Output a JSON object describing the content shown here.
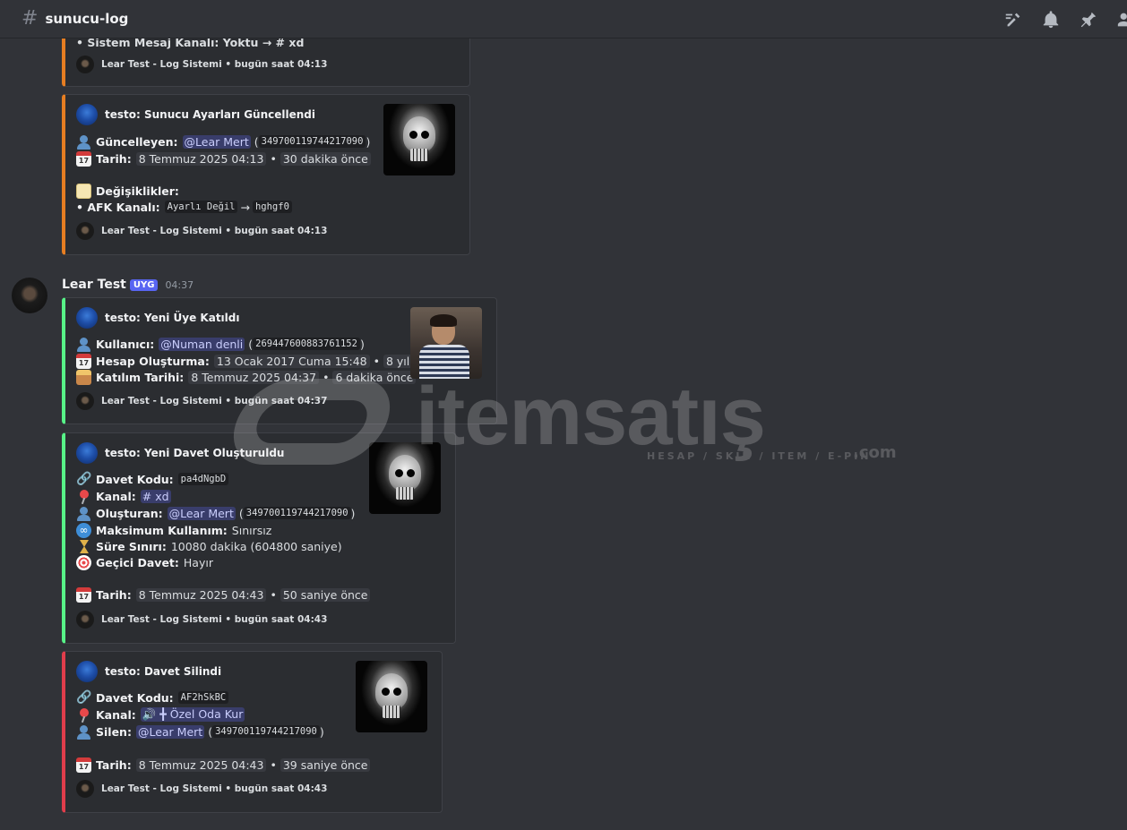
{
  "channel": {
    "name": "sunucu-log"
  },
  "header_icons": [
    "threads-icon",
    "bell-icon",
    "pin-icon",
    "members-icon"
  ],
  "embed0": {
    "partial_line": "• Sistem Mesaj Kanalı: Yoktu → # xd",
    "footer": "Lear Test - Log Sistemi • bugün saat 04:13"
  },
  "embed1": {
    "author": "testo: Sunucu Ayarları Güncellendi",
    "updater_label": "Güncelleyen:",
    "updater_mention": "@Lear Mert",
    "updater_id": "349700119744217090",
    "date_label": "Tarih:",
    "date_value": "8 Temmuz 2025 04:13",
    "date_rel": "30 dakika önce",
    "changes_label": "Değişiklikler:",
    "change_label": "• AFK Kanalı:",
    "change_old": "Ayarlı Değil",
    "change_arrow": "→",
    "change_new": "hghgf0",
    "footer": "Lear Test - Log Sistemi • bugün saat 04:13"
  },
  "message": {
    "username": "Lear Test",
    "tag": "UYG",
    "time": "04:37"
  },
  "embed2": {
    "author": "testo: Yeni Üye Katıldı",
    "user_label": "Kullanıcı:",
    "user_mention": "@Numan denli",
    "user_id": "269447600883761152",
    "created_label": "Hesap Oluşturma:",
    "created_value": "13 Ocak 2017 Cuma 15:48",
    "created_rel": "8 yıl önce",
    "joined_label": "Katılım Tarihi:",
    "joined_value": "8 Temmuz 2025 04:37",
    "joined_rel": "6 dakika önce",
    "footer": "Lear Test - Log Sistemi • bugün saat 04:37"
  },
  "embed3": {
    "author": "testo: Yeni Davet Oluşturuldu",
    "code_label": "Davet Kodu:",
    "code_value": "pa4dNgbD",
    "channel_label": "Kanal:",
    "channel_value": "# xd",
    "creator_label": "Oluşturan:",
    "creator_mention": "@Lear Mert",
    "creator_id": "349700119744217090",
    "max_label": "Maksimum Kullanım:",
    "max_value": "Sınırsız",
    "limit_label": "Süre Sınırı:",
    "limit_value": "10080 dakika (604800 saniye)",
    "temp_label": "Geçici Davet:",
    "temp_value": "Hayır",
    "date_label": "Tarih:",
    "date_value": "8 Temmuz 2025 04:43",
    "date_rel": "50 saniye önce",
    "footer": "Lear Test - Log Sistemi • bugün saat 04:43"
  },
  "embed4": {
    "author": "testo: Davet Silindi",
    "code_label": "Davet Kodu:",
    "code_value": "AF2hSkBC",
    "channel_label": "Kanal:",
    "channel_value": "🔊 ╋ Özel Oda Kur",
    "deleter_label": "Silen:",
    "deleter_mention": "@Lear Mert",
    "deleter_id": "349700119744217090",
    "date_label": "Tarih:",
    "date_value": "8 Temmuz 2025 04:43",
    "date_rel": "39 saniye önce",
    "footer": "Lear Test - Log Sistemi • bugün saat 04:43"
  },
  "watermark": {
    "brand": "itemsatış",
    "sub": "HESAP / SKIN / ITEM / E-PIN",
    "suffix": ".com"
  },
  "colors": {
    "orange": "#e67e22",
    "green": "#57f287",
    "red": "#e03d4b",
    "blurple": "#5865f2",
    "bg": "#313338",
    "embed_bg": "#2b2d31"
  }
}
